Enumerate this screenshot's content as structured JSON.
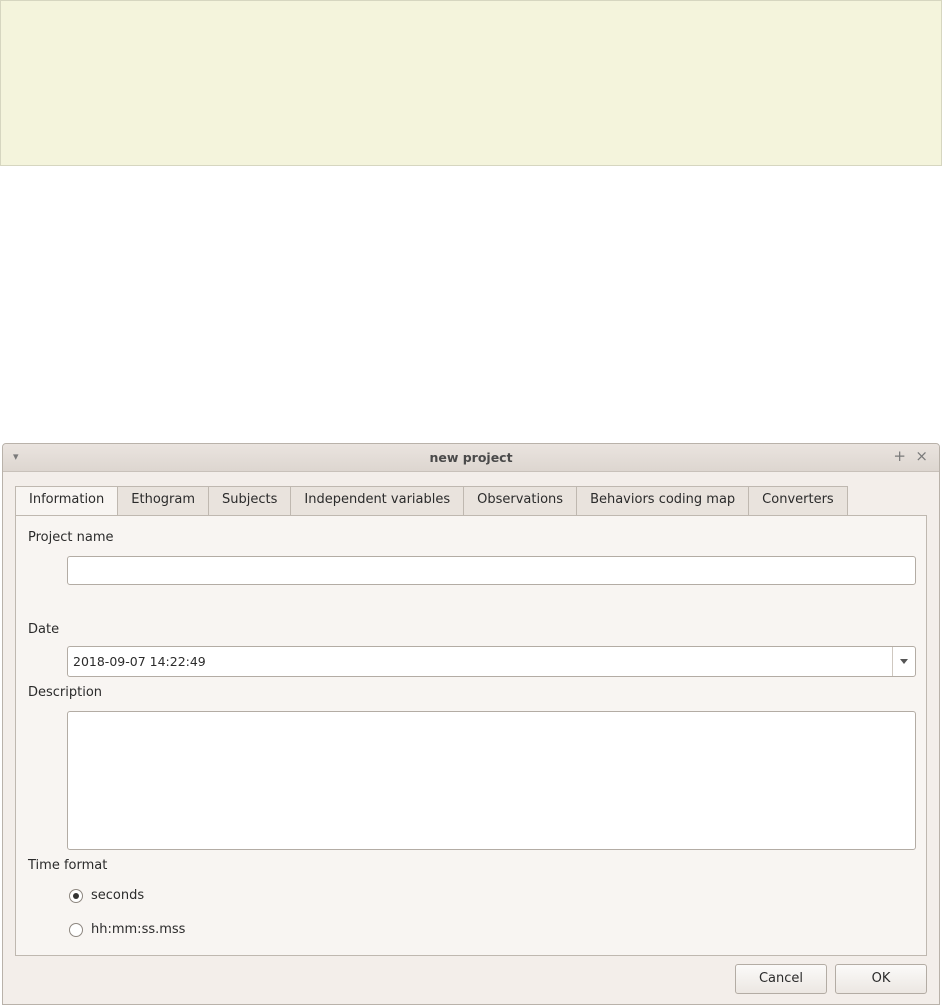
{
  "window": {
    "title": "new project"
  },
  "tabs": [
    "Information",
    "Ethogram",
    "Subjects",
    "Independent variables",
    "Observations",
    "Behaviors coding map",
    "Converters"
  ],
  "form": {
    "project_name_label": "Project name",
    "project_name_value": "",
    "date_label": "Date",
    "date_value": "2018-09-07 14:22:49",
    "description_label": "Description",
    "description_value": "",
    "time_format_label": "Time format",
    "time_format_options": [
      "seconds",
      "hh:mm:ss.mss"
    ],
    "time_format_selected": "seconds"
  },
  "buttons": {
    "cancel": "Cancel",
    "ok": "OK"
  },
  "icons": {
    "menu": "chevron-down-icon",
    "pin": "pin-icon",
    "close": "close-icon"
  },
  "colors": {
    "banner": "#f4f4dc",
    "window_bg": "#f3eeea",
    "panel_bg": "#f8f5f2"
  }
}
